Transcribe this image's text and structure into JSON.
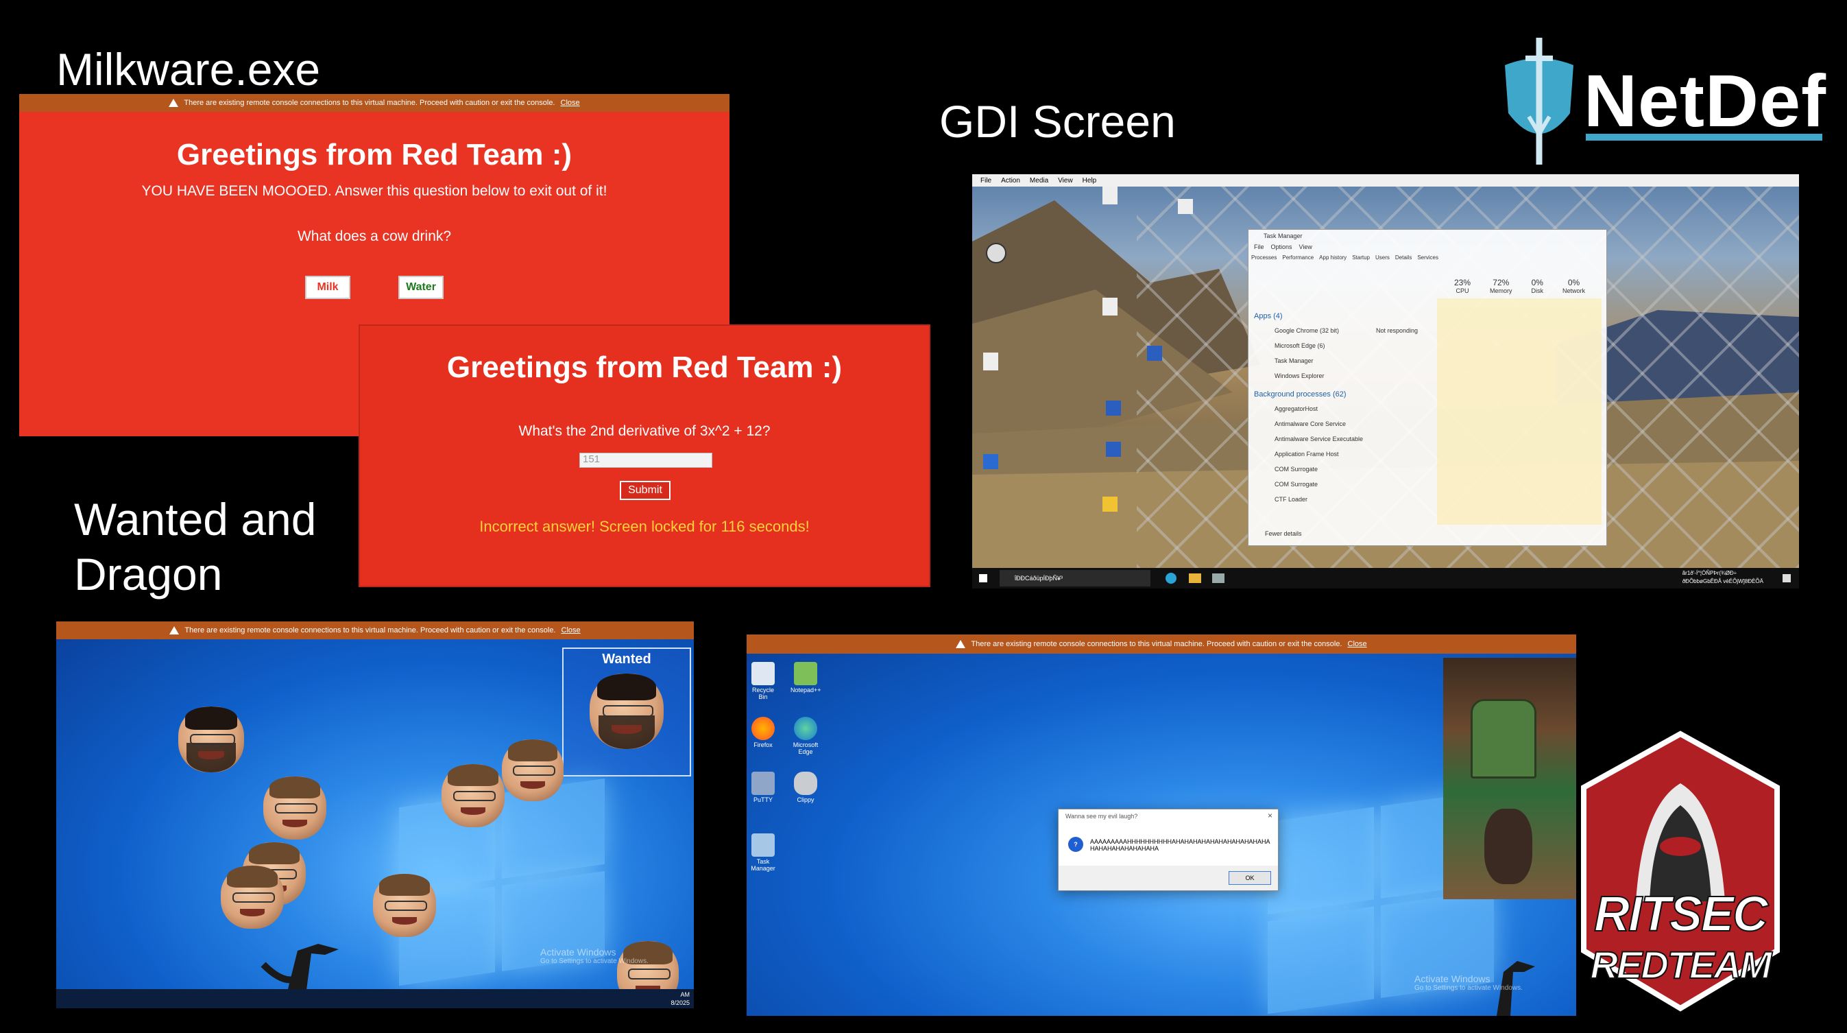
{
  "headings": {
    "milkware": "Milkware.exe",
    "gdi": "GDI Screen",
    "wanted": "Wanted and",
    "dragon": "Dragon"
  },
  "logos": {
    "netdef": "NetDef",
    "ritsec_top": "RITSEC",
    "ritsec_bottom": "REDTEAM"
  },
  "vm_warning": {
    "text": "There are existing remote console connections to this virtual machine. Proceed with caution or exit the console.",
    "close": "Close"
  },
  "milk_panel": {
    "title": "Greetings from Red Team :)",
    "subtitle": "YOU HAVE BEEN MOOOED. Answer this question below to exit out of it!",
    "question": "What does a cow drink?",
    "options": [
      "Milk",
      "Water"
    ]
  },
  "math_panel": {
    "title": "Greetings from Red Team :)",
    "question": "What's the 2nd derivative of 3x^2 + 12?",
    "input_value": "151",
    "submit": "Submit",
    "error": "Incorrect answer! Screen locked for 116 seconds!"
  },
  "gdi_screen": {
    "menu": [
      "File",
      "Action",
      "Media",
      "View",
      "Help"
    ],
    "task_manager": {
      "title": "Task Manager",
      "menu": [
        "File",
        "Options",
        "View"
      ],
      "tabs": [
        "Processes",
        "Performance",
        "App history",
        "Startup",
        "Users",
        "Details",
        "Services"
      ],
      "stats": [
        {
          "value": "23%",
          "label": "CPU"
        },
        {
          "value": "72%",
          "label": "Memory"
        },
        {
          "value": "0%",
          "label": "Disk"
        },
        {
          "value": "0%",
          "label": "Network"
        }
      ],
      "apps_header": "Apps (4)",
      "apps": [
        "Google Chrome (32 bit)",
        "Microsoft Edge (6)",
        "Task Manager",
        "Windows Explorer"
      ],
      "apps_status": "Not responding",
      "bg_header": "Background processes (62)",
      "bg_processes": [
        "AggregatorHost",
        "Antimalware Core Service",
        "Antimalware Service Executable",
        "Application Frame Host",
        "COM Surrogate",
        "COM Surrogate",
        "CTF Loader"
      ],
      "fewer_details": "Fewer details"
    },
    "taskbar_search": "ΐÐÐCáðüpÍÐþÑ¥³",
    "tray_text_1": "ãr1ð'-Í^¦ÓÑPÞr(¾ØÐ÷",
    "tray_text_2": "ðÐÕbbøGbÊÐÅ vèÉÕjW]8ÐÈÕÄ"
  },
  "wanted_screen": {
    "wanted_label": "Wanted",
    "activate_line1": "Activate Windows",
    "activate_line2": "Go to Settings to activate Windows.",
    "clock_time": "AM",
    "clock_date": "8/2025"
  },
  "dragon_screen": {
    "desktop_icons": [
      "Recycle Bin",
      "Notepad++",
      "Firefox",
      "Microsoft Edge",
      "PuTTY",
      "Clippy",
      "Task Manager"
    ],
    "dialog_title": "Wanna see my evil laugh?",
    "dialog_text_1": "AAAAAAAAAHHHHHHHHHHAHAHAHAHAHAHAHAHAHAHAHA",
    "dialog_text_2": "HAHAHAHAHAHAHAHA",
    "dialog_ok": "OK",
    "activate_line1": "Activate Windows",
    "activate_line2": "Go to Settings to activate Windows."
  },
  "colors": {
    "red_panel": "#e93323",
    "warn_bar": "#b5561d",
    "error_text": "#ffd23a",
    "netdef_blue": "#3fa7c9"
  }
}
